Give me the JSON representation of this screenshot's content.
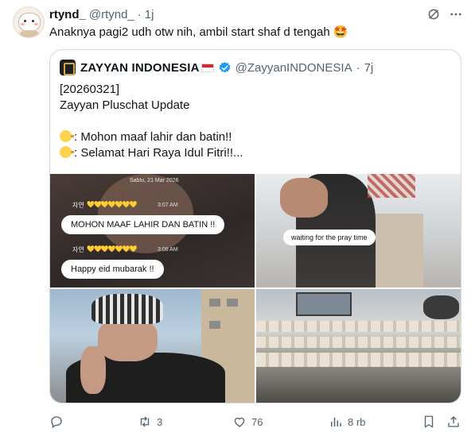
{
  "tweet": {
    "author_name": "rtynd_",
    "author_handle": "@rtynd_",
    "separator": "·",
    "time": "1j",
    "text": "Anaknya pagi2 udh otw nih, ambil start shaf d tengah 🤩"
  },
  "quoted": {
    "author_name": "ZAYYAN INDONESIA",
    "author_handle": "@ZayyanINDONESIA",
    "separator": "·",
    "time": "7j",
    "lines": [
      "[20260321]",
      "Zayyan Pluschat Update",
      "",
      ": Mohon maaf lahir dan batin!!",
      ": Selamat Hari Raya Idul Fitri!!..."
    ],
    "media": {
      "chat_date": "Sabtu, 21 Mar 2026",
      "chat_sender": "자연",
      "chat_hearts": "💛💛💛💛💛💛💛",
      "chat_time_1": "3:07 AM",
      "chat_time_2": "3:08 AM",
      "bubble_1": "MOHON MAAF LAHIR DAN BATIN !!",
      "bubble_2": "Happy eid mubarak !!",
      "caption": "waiting for the pray time"
    }
  },
  "actions": {
    "replies": "",
    "retweets": "3",
    "likes": "76",
    "views": "8 rb"
  },
  "colors": {
    "text": "#0f1419",
    "secondary": "#536471",
    "border": "#cfd9de",
    "verified": "#1d9bf0"
  }
}
